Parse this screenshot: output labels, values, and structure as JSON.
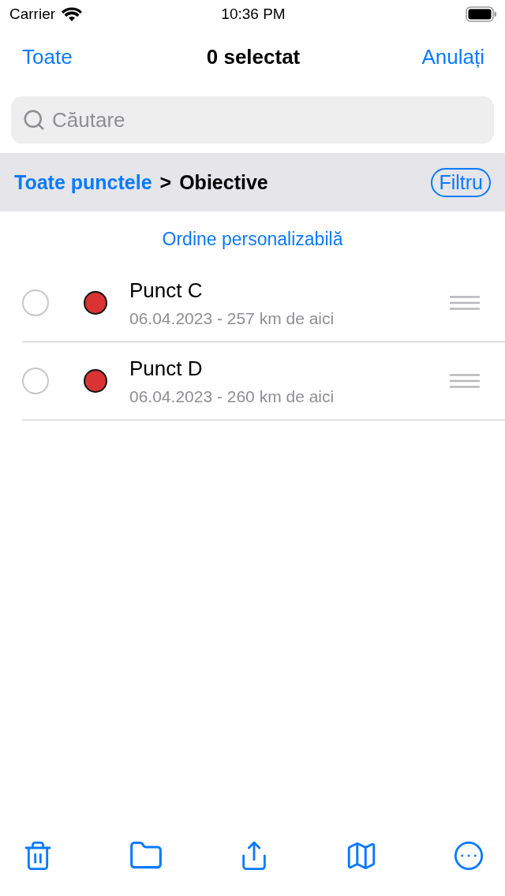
{
  "status_bar": {
    "carrier": "Carrier",
    "time": "10:36 PM"
  },
  "nav": {
    "left": "Toate",
    "title": "0 selectat",
    "right": "Anulați"
  },
  "search": {
    "placeholder": "Căutare"
  },
  "breadcrumb": {
    "link": "Toate punctele",
    "separator": ">",
    "current": "Obiective",
    "filter": "Filtru"
  },
  "section_header": "Ordine personalizabilă",
  "rows": [
    {
      "title": "Punct C",
      "subtitle": "06.04.2023 - 257 km de aici",
      "selected": false,
      "color": "#d93333"
    },
    {
      "title": "Punct D",
      "subtitle": "06.04.2023 - 260 km de aici",
      "selected": false,
      "color": "#d93333"
    }
  ],
  "toolbar": [
    {
      "kind": "trash"
    },
    {
      "kind": "folder"
    },
    {
      "kind": "share"
    },
    {
      "kind": "map"
    },
    {
      "kind": "more"
    }
  ]
}
